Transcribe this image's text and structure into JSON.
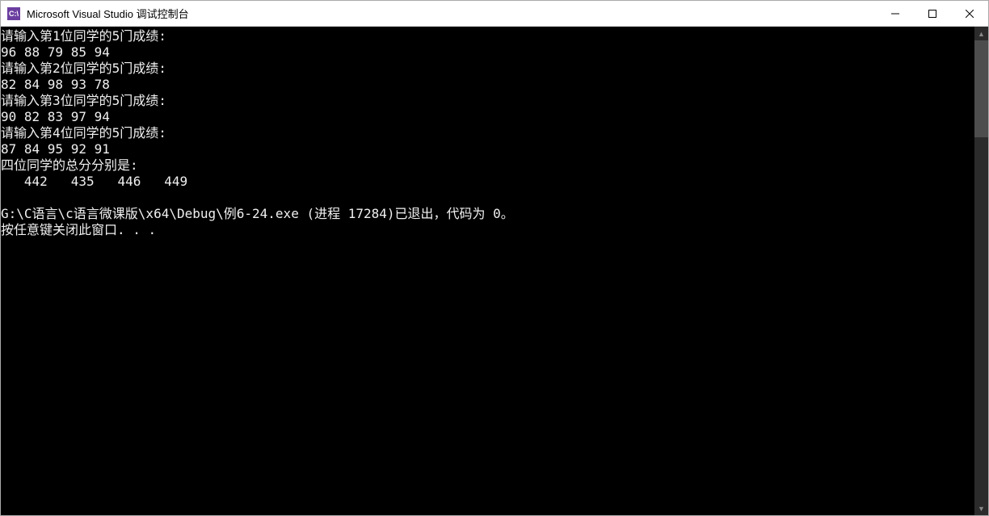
{
  "window": {
    "title": "Microsoft Visual Studio 调试控制台",
    "icon_label": "C:\\"
  },
  "console": {
    "lines": [
      "请输入第1位同学的5门成绩:",
      "96 88 79 85 94",
      "请输入第2位同学的5门成绩:",
      "82 84 98 93 78",
      "请输入第3位同学的5门成绩:",
      "90 82 83 97 94",
      "请输入第4位同学的5门成绩:",
      "87 84 95 92 91",
      "四位同学的总分分别是:",
      "   442   435   446   449",
      "",
      "G:\\C语言\\c语言微课版\\x64\\Debug\\例6-24.exe (进程 17284)已退出，代码为 0。",
      "按任意键关闭此窗口. . ."
    ]
  }
}
